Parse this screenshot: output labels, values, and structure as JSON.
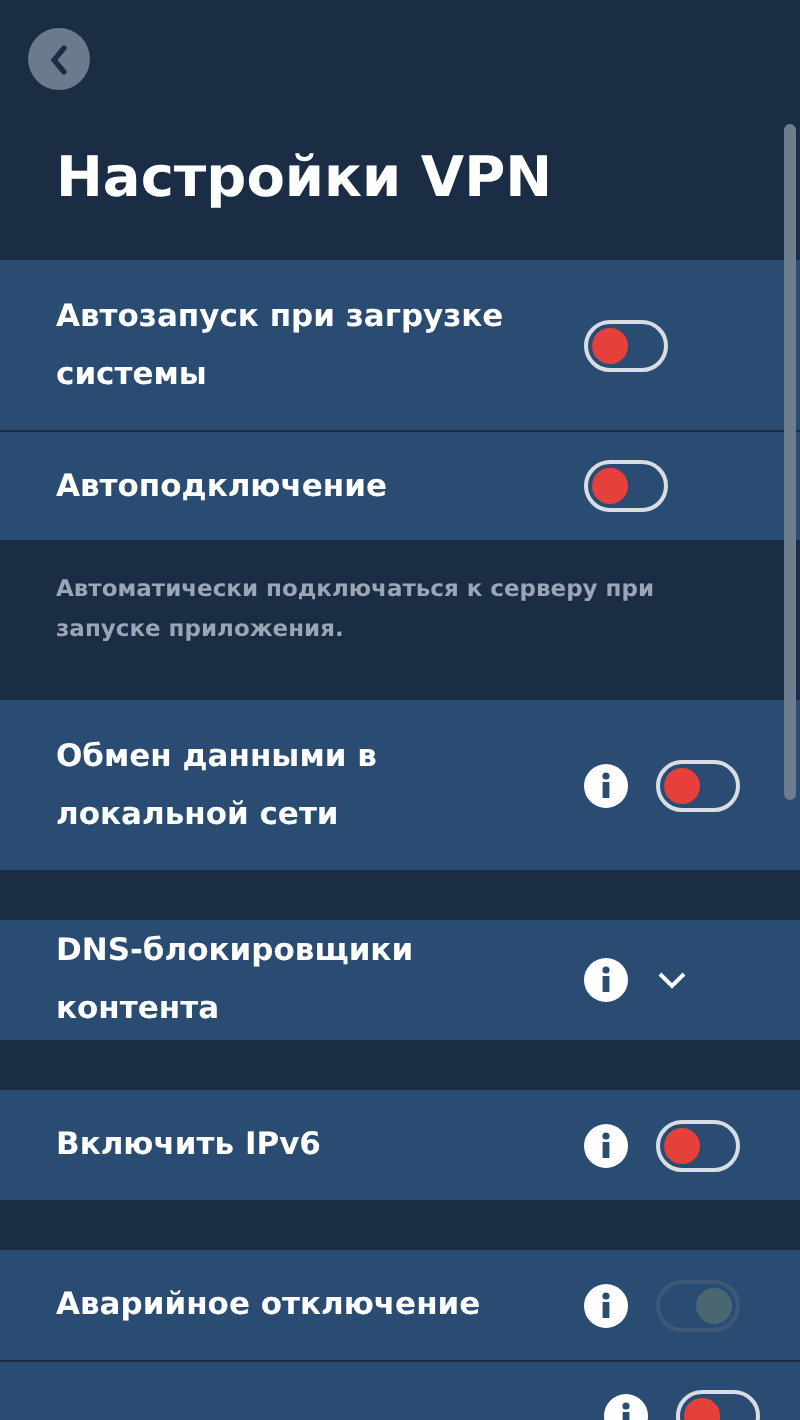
{
  "title": "Настройки VPN",
  "sections": [
    {
      "rows": [
        {
          "kind": "toggle",
          "label": "Автозапуск при загрузке системы",
          "info": false,
          "on": false,
          "disabled": false
        },
        {
          "kind": "toggle",
          "label": "Автоподключение",
          "info": false,
          "on": false,
          "disabled": false
        }
      ],
      "note": "Автоматически подключаться к серверу при запуске приложения."
    },
    {
      "rows": [
        {
          "kind": "toggle",
          "label": "Обмен данными в локальной сети",
          "info": true,
          "on": false,
          "disabled": false
        }
      ]
    },
    {
      "rows": [
        {
          "kind": "expander",
          "label": "DNS-блокировщики контента",
          "info": true,
          "expanded": false
        }
      ]
    },
    {
      "rows": [
        {
          "kind": "toggle",
          "label": "Включить IPv6",
          "info": true,
          "on": false,
          "disabled": false
        }
      ]
    },
    {
      "rows": [
        {
          "kind": "toggle",
          "label": "Аварийное отключение",
          "info": true,
          "on": true,
          "disabled": true
        },
        {
          "kind": "toggle",
          "info": true,
          "on": false,
          "disabled": false
        }
      ]
    }
  ]
}
